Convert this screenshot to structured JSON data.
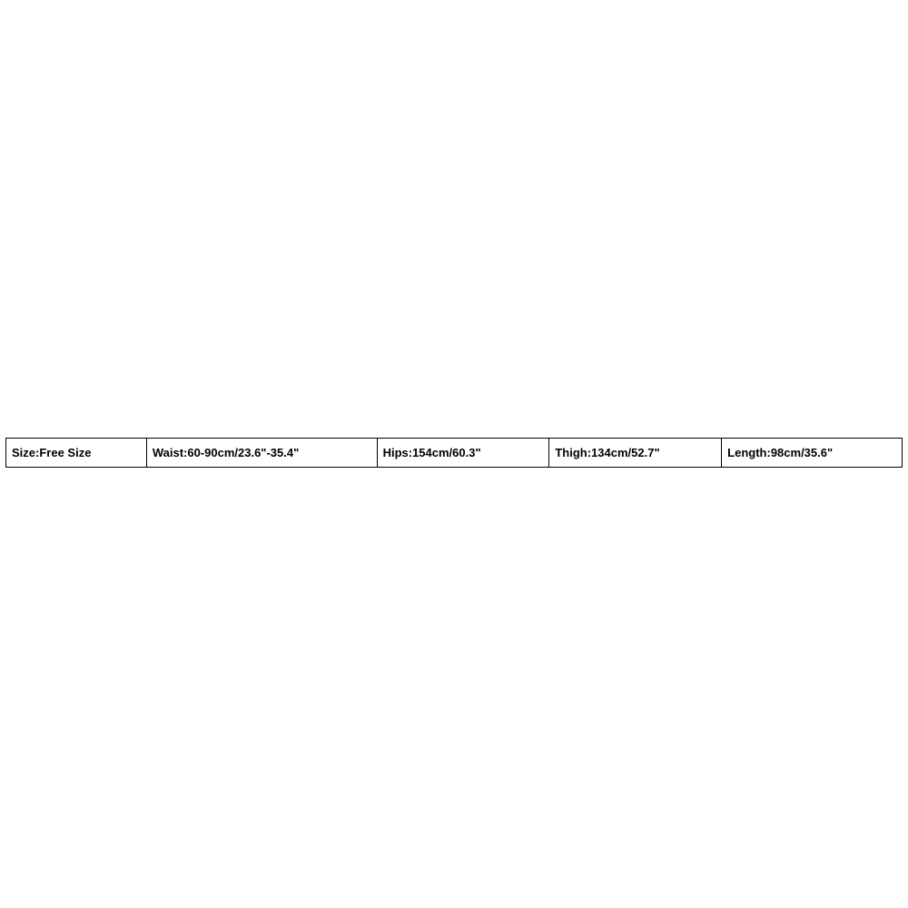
{
  "size_table": {
    "cells": [
      "Size:Free Size",
      "Waist:60-90cm/23.6\"-35.4\"",
      "Hips:154cm/60.3\"",
      "Thigh:134cm/52.7\"",
      "Length:98cm/35.6\""
    ]
  }
}
